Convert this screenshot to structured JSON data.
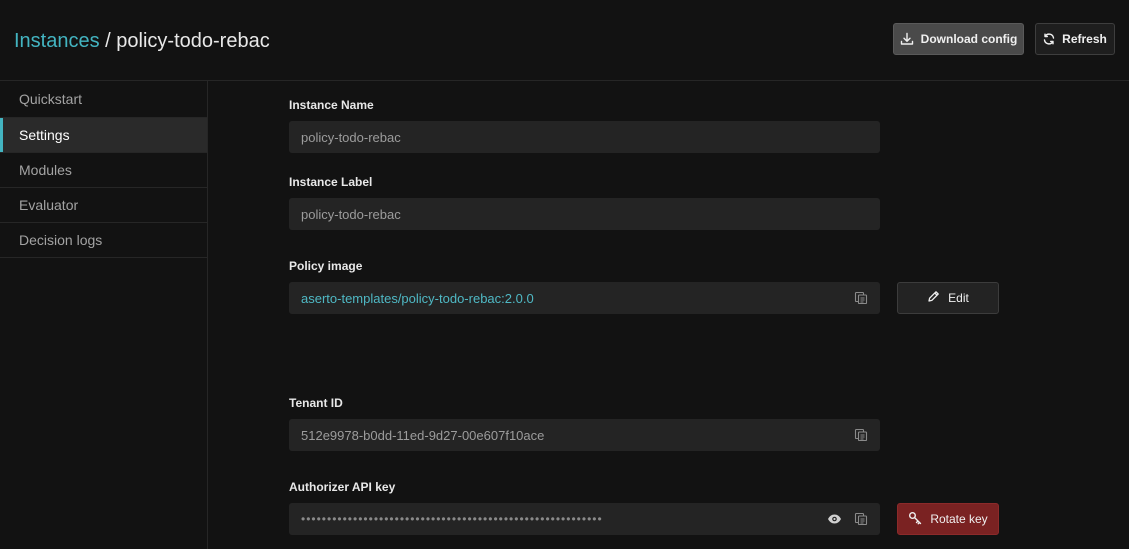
{
  "header": {
    "breadcrumb_root": "Instances",
    "separator": " / ",
    "current": "policy-todo-rebac",
    "download_label": "Download config",
    "refresh_label": "Refresh"
  },
  "sidebar": {
    "items": [
      {
        "label": "Quickstart",
        "active": false
      },
      {
        "label": "Settings",
        "active": true
      },
      {
        "label": "Modules",
        "active": false
      },
      {
        "label": "Evaluator",
        "active": false
      },
      {
        "label": "Decision logs",
        "active": false
      }
    ]
  },
  "form": {
    "instance_name": {
      "label": "Instance Name",
      "value": "policy-todo-rebac"
    },
    "instance_label": {
      "label": "Instance Label",
      "value": "policy-todo-rebac"
    },
    "policy_image": {
      "label": "Policy image",
      "value": "aserto-templates/policy-todo-rebac:2.0.0",
      "edit_label": "Edit"
    },
    "tenant_id": {
      "label": "Tenant ID",
      "value": "512e9978-b0dd-11ed-9d27-00e607f10ace"
    },
    "api_key": {
      "label": "Authorizer API key",
      "value": "••••••••••••••••••••••••••••••••••••••••••••••••••••••••••",
      "rotate_label": "Rotate key"
    }
  },
  "icons": {
    "download": "download-icon",
    "refresh": "refresh-icon",
    "copy": "copy-icon",
    "pencil": "pencil-icon",
    "eye": "eye-icon",
    "key": "key-icon"
  },
  "colors": {
    "accent": "#43b4c1",
    "danger": "#7a2222",
    "background": "#121212",
    "field": "#242424"
  }
}
